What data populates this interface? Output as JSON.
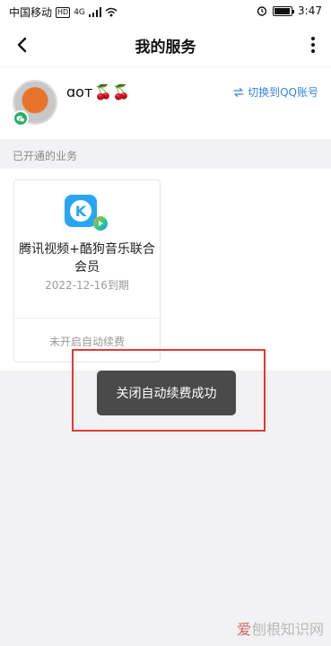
{
  "status_bar": {
    "carrier": "中国移动",
    "hd_badge": "HD",
    "network": "4G",
    "time": "3:47"
  },
  "nav": {
    "title": "我的服务"
  },
  "profile": {
    "username": "ɑoᴛ",
    "username_emoji": "🍒🍒",
    "switch_label": "切换到QQ账号"
  },
  "services": {
    "section_label": "已开通的业务",
    "items": [
      {
        "name": "腾讯视频+酷狗音乐联合会员",
        "expiry": "2022-12-16到期",
        "renew_status": "未开启自动续费",
        "icon": "kugou-music-icon"
      }
    ]
  },
  "toast": {
    "message": "关闭自动续费成功"
  },
  "watermark": {
    "text_red": "爱",
    "text_grey": "刨根知识网"
  },
  "colors": {
    "accent": "#3a84e0",
    "annotation_red": "#e23a34",
    "toast_bg": "#4a4a4a"
  }
}
